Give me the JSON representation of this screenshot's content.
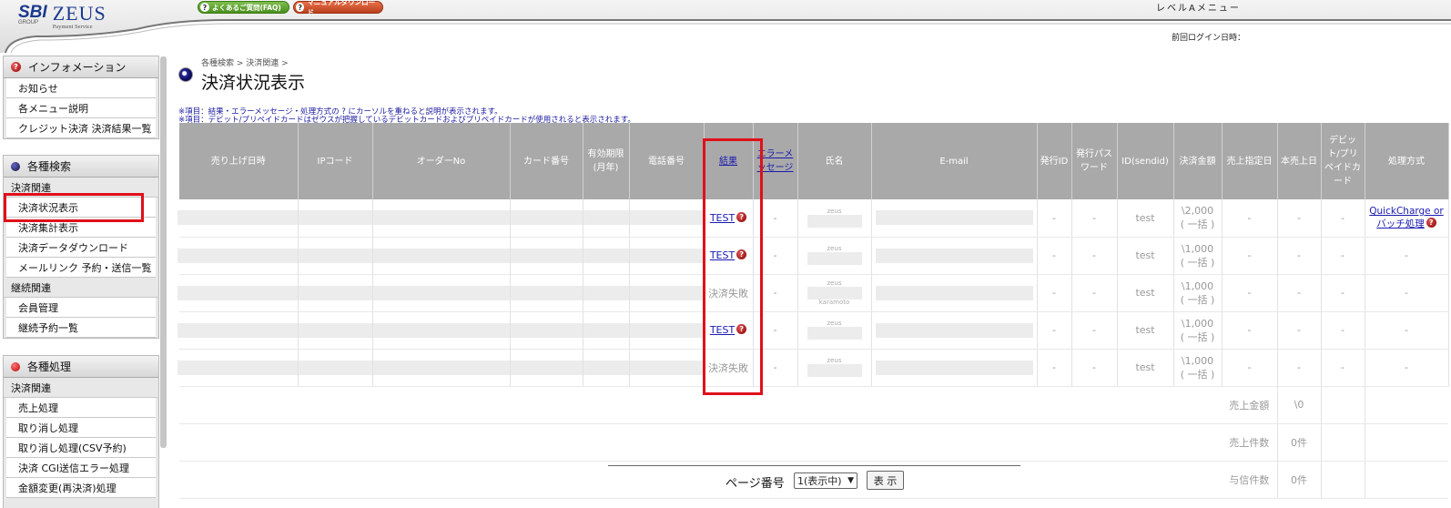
{
  "header": {
    "logo_sbi": "SBI",
    "logo_group": "GROUP",
    "logo_zeus": "ZEUS",
    "logo_service": "Payment Service",
    "faq_button": "よくあるご質問(FAQ)",
    "manual_button": "マニュアルダウンロード",
    "level_menu": "レベルAメニュー",
    "last_login": "前回ログイン日時："
  },
  "sidebar": {
    "info": {
      "title": "インフォメーション",
      "items": [
        "お知らせ",
        "各メニュー説明",
        "クレジット決済 決済結果一覧"
      ]
    },
    "search": {
      "title": "各種検索",
      "cat1": "決済関連",
      "items1": [
        "決済状況表示",
        "決済集計表示",
        "決済データダウンロード",
        "メールリンク 予約・送信一覧"
      ],
      "cat2": "継続関連",
      "items2": [
        "会員管理",
        "継続予約一覧"
      ]
    },
    "process": {
      "title": "各種処理",
      "cat1": "決済関連",
      "items1": [
        "売上処理",
        "取り消し処理",
        "取り消し処理(CSV予約)",
        "決済 CGI送信エラー処理",
        "金額変更(再決済)処理"
      ]
    }
  },
  "main": {
    "breadcrumb": "各種検索 > 決済関連 >",
    "title": "決済状況表示",
    "note1": "※項目：結果・エラーメッセージ・処理方式の ? にカーソルを重ねると説明が表示されます。",
    "note2": "※項目：デビット/プリペイドカードはゼウスが把握しているデビットカードおよびプリペイドカードが使用されると表示されます。",
    "columns": {
      "sale_date": "売り上げ日時",
      "ip": "IPコード",
      "order": "オーダーNo",
      "card": "カード番号",
      "expiry": "有効期限(月年)",
      "phone": "電話番号",
      "result": "結果",
      "error": "エラーメッセージ",
      "name": "氏名",
      "email": "E-mail",
      "issue_id": "発行ID",
      "issue_pw": "発行パスワード",
      "sendid": "ID(sendid)",
      "amount": "決済金額",
      "sale_spec": "売上指定日",
      "actual_sale": "本売上日",
      "debit": "デビット/プリペイドカード",
      "method": "処理方式"
    },
    "rows": [
      {
        "result": "TEST",
        "dash": "-",
        "zeus": "zeus",
        "sendid": "test",
        "amount": "\\2,000",
        "amount_type": "( 一括 )",
        "method1": "QuickCharge or",
        "method2": "バッチ処理"
      },
      {
        "result": "TEST",
        "dash": "-",
        "zeus": "zeus",
        "sendid": "test",
        "amount": "\\1,000",
        "amount_type": "( 一括 )",
        "method1": "-",
        "method2": ""
      },
      {
        "result": "決済失敗",
        "dash": "-",
        "zeus": "zeus",
        "name2": "karamoto",
        "sendid": "test",
        "amount": "\\1,000",
        "amount_type": "( 一括 )",
        "method1": "-",
        "method2": ""
      },
      {
        "result": "TEST",
        "dash": "-",
        "zeus": "zeus",
        "sendid": "test",
        "amount": "\\1,000",
        "amount_type": "( 一括 )",
        "method1": "-",
        "method2": ""
      },
      {
        "result": "決済失敗",
        "dash": "-",
        "zeus": "zeus",
        "sendid": "test",
        "amount": "\\1,000",
        "amount_type": "( 一括 )",
        "method1": "-",
        "method2": ""
      }
    ],
    "summary": [
      {
        "label": "売上金額",
        "value": "\\0"
      },
      {
        "label": "売上件数",
        "value": "0件"
      },
      {
        "label": "与信件数",
        "value": "0件"
      }
    ],
    "pager": {
      "label": "ページ番号",
      "selected": "1(表示中)",
      "button": "表 示"
    }
  }
}
